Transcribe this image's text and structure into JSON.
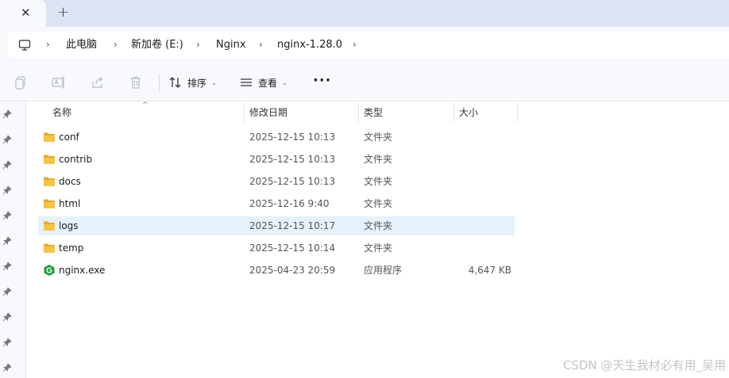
{
  "tabs": {
    "close_glyph": "✕",
    "new_tab_glyph": "+"
  },
  "breadcrumb": {
    "icon": "computer-icon",
    "separator": "›",
    "items": [
      "此电脑",
      "新加卷 (E:)",
      "Nginx",
      "nginx-1.28.0"
    ]
  },
  "toolbar": {
    "icons": [
      "copy-icon",
      "rename-icon",
      "share-icon",
      "delete-icon"
    ],
    "sort_label": "排序",
    "view_label": "查看",
    "more_label": "···",
    "dropdown_glyph": "⌄"
  },
  "columns": {
    "name": "名称",
    "date": "修改日期",
    "type": "类型",
    "size": "大小",
    "sort_glyph": "^"
  },
  "files": [
    {
      "name": "conf",
      "date": "2025-12-15 10:13",
      "type": "文件夹",
      "size": "",
      "icon": "folder-icon"
    },
    {
      "name": "contrib",
      "date": "2025-12-15 10:13",
      "type": "文件夹",
      "size": "",
      "icon": "folder-icon"
    },
    {
      "name": "docs",
      "date": "2025-12-15 10:13",
      "type": "文件夹",
      "size": "",
      "icon": "folder-icon"
    },
    {
      "name": "html",
      "date": "2025-12-16 9:40",
      "type": "文件夹",
      "size": "",
      "icon": "folder-icon"
    },
    {
      "name": "logs",
      "date": "2025-12-15 10:17",
      "type": "文件夹",
      "size": "",
      "icon": "folder-icon",
      "selected": true
    },
    {
      "name": "temp",
      "date": "2025-12-15 10:14",
      "type": "文件夹",
      "size": "",
      "icon": "folder-icon"
    },
    {
      "name": "nginx.exe",
      "date": "2025-04-23 20:59",
      "type": "应用程序",
      "size": "4,647 KB",
      "icon": "nginx-app-icon"
    }
  ],
  "watermark": "CSDN @天生我材必有用_吴用",
  "colors": {
    "folder": "#f6c344",
    "folder_dark": "#e8a92a",
    "selection": "#e5f1fb",
    "nginx_green": "#1f9b3a"
  }
}
